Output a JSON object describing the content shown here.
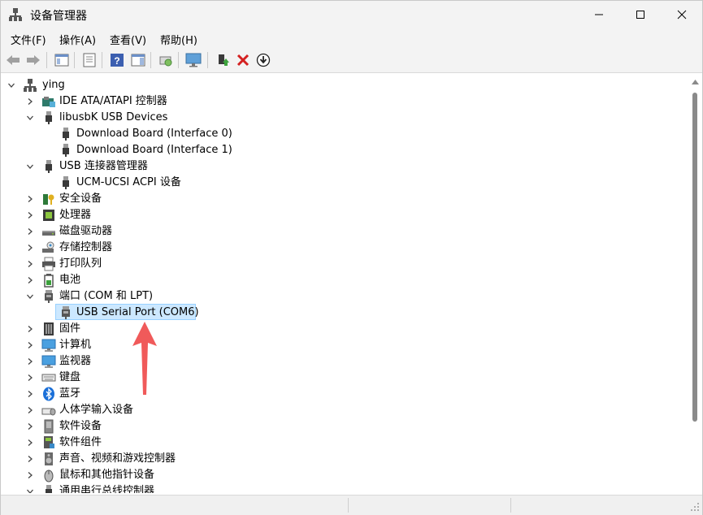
{
  "window": {
    "title": "设备管理器"
  },
  "menu": [
    "文件(F)",
    "操作(A)",
    "查看(V)",
    "帮助(H)"
  ],
  "toolbar": {
    "buttons": [
      "back",
      "forward",
      "show-hide-console-tree",
      "properties",
      "help",
      "action-pane",
      "scan-hardware",
      "monitor",
      "update-driver",
      "uninstall-device",
      "disable-device"
    ]
  },
  "tree": {
    "root": "ying",
    "items": [
      {
        "label": "IDE ATA/ATAPI 控制器",
        "icon": "ide-controller-icon",
        "expanded": false
      },
      {
        "label": "libusbK USB Devices",
        "icon": "usb-plug-icon",
        "expanded": true
      },
      {
        "label": "Download Board (Interface 0)",
        "icon": "usb-plug-icon",
        "child": true
      },
      {
        "label": "Download Board (Interface 1)",
        "icon": "usb-plug-icon",
        "child": true
      },
      {
        "label": "USB 连接器管理器",
        "icon": "usb-plug-icon",
        "expanded": true
      },
      {
        "label": "UCM-UCSI ACPI 设备",
        "icon": "usb-plug-icon",
        "child": true
      },
      {
        "label": "安全设备",
        "icon": "security-key-icon",
        "expanded": false
      },
      {
        "label": "处理器",
        "icon": "processor-chip-icon",
        "expanded": false
      },
      {
        "label": "磁盘驱动器",
        "icon": "disk-drive-icon",
        "expanded": false
      },
      {
        "label": "存储控制器",
        "icon": "storage-controller-icon",
        "expanded": false
      },
      {
        "label": "打印队列",
        "icon": "printer-icon",
        "expanded": false
      },
      {
        "label": "电池",
        "icon": "battery-icon",
        "expanded": false
      },
      {
        "label": "端口 (COM 和 LPT)",
        "icon": "port-icon",
        "expanded": true
      },
      {
        "label": "USB Serial Port (COM6)",
        "icon": "port-icon",
        "child": true,
        "selected": true
      },
      {
        "label": "固件",
        "icon": "firmware-icon",
        "expanded": false
      },
      {
        "label": "计算机",
        "icon": "computer-icon",
        "expanded": false
      },
      {
        "label": "监视器",
        "icon": "monitor-icon",
        "expanded": false
      },
      {
        "label": "键盘",
        "icon": "keyboard-icon",
        "expanded": false
      },
      {
        "label": "蓝牙",
        "icon": "bluetooth-icon",
        "expanded": false
      },
      {
        "label": "人体学输入设备",
        "icon": "hid-icon",
        "expanded": false
      },
      {
        "label": "软件设备",
        "icon": "software-device-icon",
        "expanded": false
      },
      {
        "label": "软件组件",
        "icon": "software-component-icon",
        "expanded": false
      },
      {
        "label": "声音、视频和游戏控制器",
        "icon": "speaker-icon",
        "expanded": false
      },
      {
        "label": "鼠标和其他指针设备",
        "icon": "mouse-icon",
        "expanded": false
      },
      {
        "label": "通用串行总线控制器",
        "icon": "usb-controller-icon",
        "expanded": true
      }
    ]
  },
  "colors": {
    "selection": "#cce8ff",
    "arrow": "#f05a5a",
    "chrome": "#f3f3f3"
  }
}
